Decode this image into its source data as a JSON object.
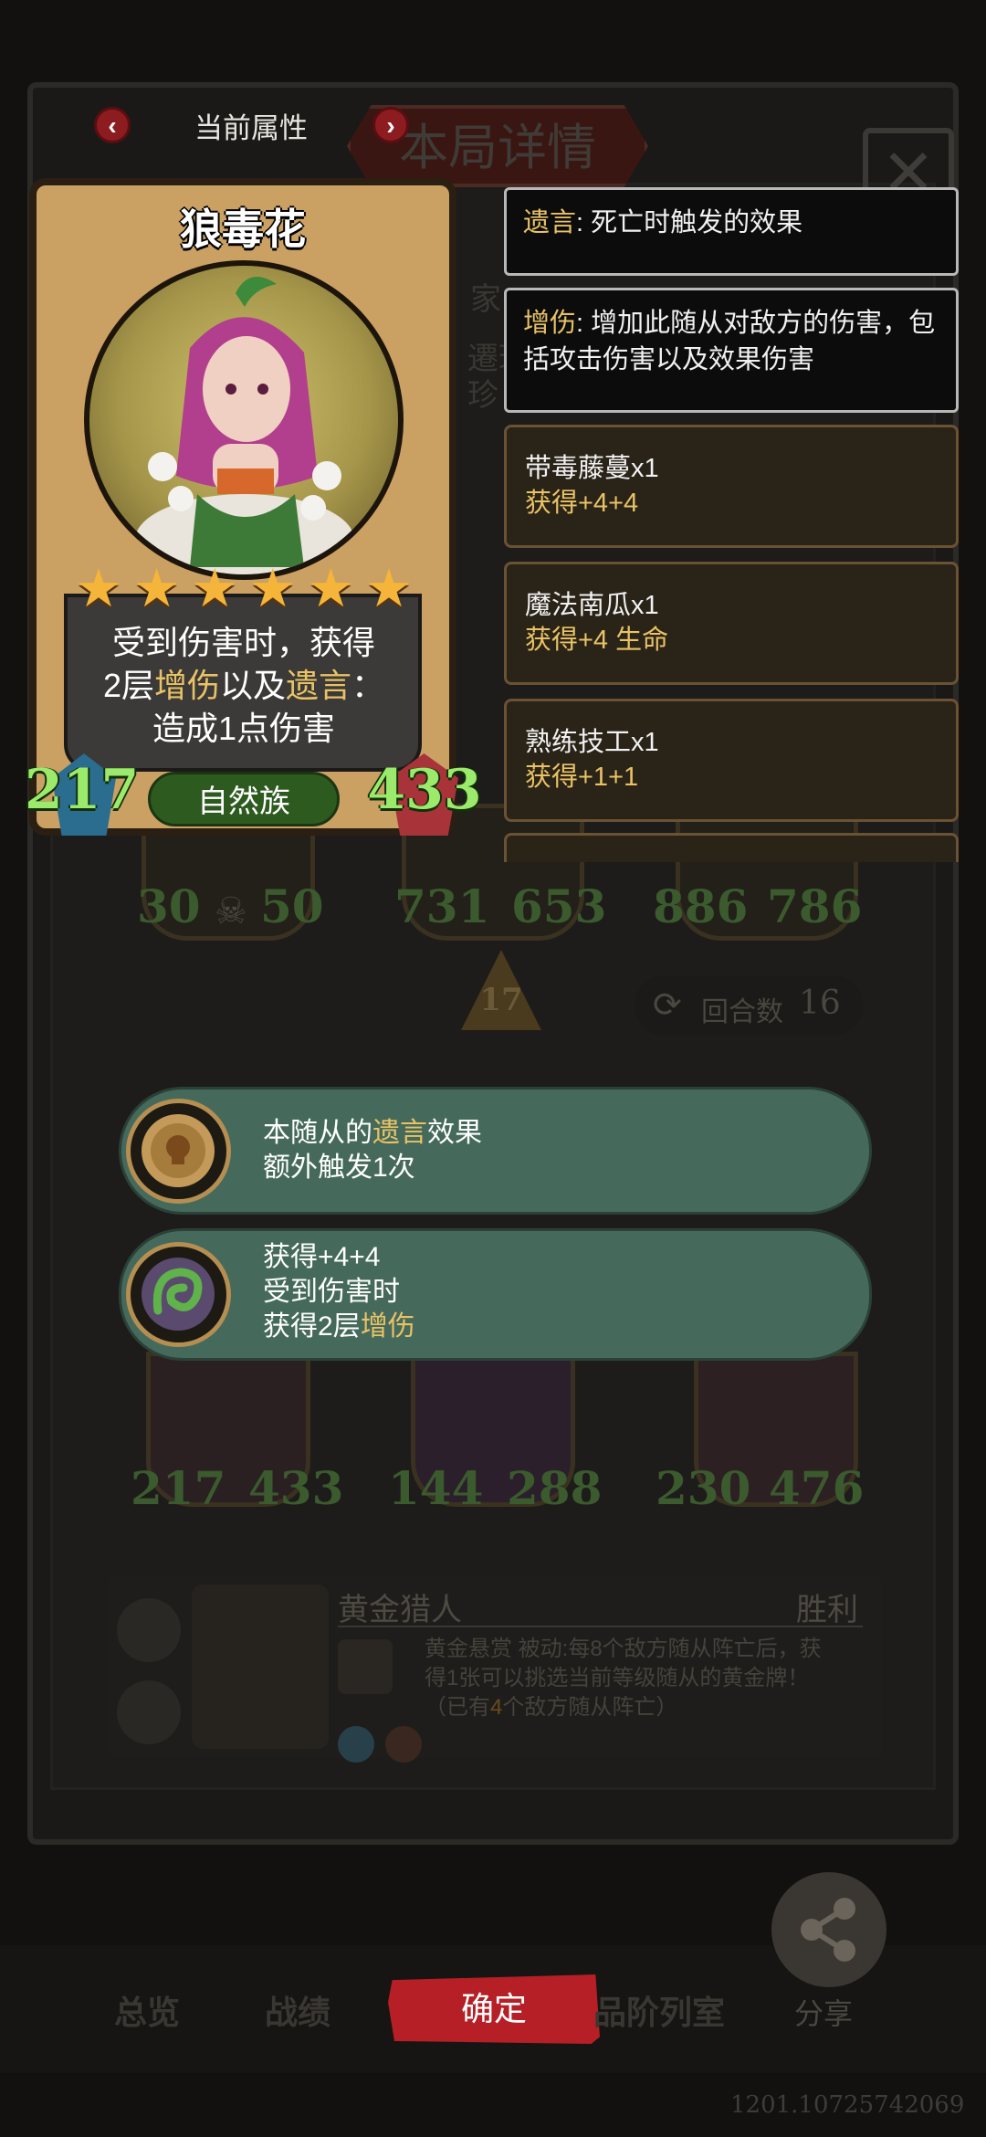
{
  "nav": {
    "prev_icon": "chevron-left-icon",
    "next_icon": "chevron-right-icon",
    "title": "当前属性"
  },
  "background": {
    "panel_title": "本局详情",
    "close_icon": "close-icon",
    "faint_a": "家",
    "faint_b": "遷珍",
    "faint_c": "珍",
    "top_stats": [
      {
        "atk": "30",
        "hp": "50"
      },
      {
        "atk": "731",
        "hp": "653"
      },
      {
        "atk": "886",
        "hp": "786"
      }
    ],
    "tier": "17",
    "round_label": "回合数",
    "round_value": "16",
    "bottom_stats": [
      {
        "atk": "217",
        "hp": "433"
      },
      {
        "atk": "144",
        "hp": "288"
      },
      {
        "atk": "230",
        "hp": "476"
      }
    ],
    "opponent_name": "黄金猎人",
    "result": "胜利",
    "skill_line1": "黄金悬赏 被动:每8个敌方随从阵亡后，获",
    "skill_line2": "得1张可以挑选当前等级随从的黄金牌！",
    "skill_line3_prefix": "（已有",
    "skill_line3_count": "4",
    "skill_line3_suffix": "个敌方随从阵亡）"
  },
  "card": {
    "name": "狼毒花",
    "stars": [
      "★",
      "★",
      "★",
      "★",
      "★",
      "★"
    ],
    "desc_line1": "受到伤害时，获得",
    "desc_line2_a": "2层",
    "desc_line2_kw1": "增伤",
    "desc_line2_b": "以及",
    "desc_line2_kw2": "遗言",
    "desc_line2_c": "：",
    "desc_line3": "造成1点伤害",
    "tribe": "自然族",
    "attack": "217",
    "health": "433"
  },
  "keywords": [
    {
      "kw": "遗言",
      "text": ": 死亡时触发的效果"
    },
    {
      "kw": "增伤",
      "text": ": 增加此随从对敌方的伤害，包括攻击伤害以及效果伤害"
    }
  ],
  "items": [
    {
      "name": "带毒藤蔓x1",
      "effect": "获得+4+4"
    },
    {
      "name": "魔法南瓜x1",
      "effect": "获得+4 生命"
    },
    {
      "name": "熟练技工x1",
      "effect": "获得+1+1"
    }
  ],
  "effects": [
    {
      "icon": "skull-coin-icon",
      "line1_a": "本随从的",
      "line1_kw": "遗言",
      "line1_b": "效果",
      "line2": "额外触发1次"
    },
    {
      "icon": "vine-icon",
      "line1": "获得+4+4",
      "line2": "受到伤害时",
      "line3_a": "获得2层",
      "line3_kw": "增伤"
    }
  ],
  "bottom": {
    "tab_overview": "总览",
    "tab_record": "战绩",
    "confirm": "确定",
    "tab_collection": "品阶列室",
    "share": "分享",
    "version": "1201.10725742069"
  },
  "colors": {
    "accent_red": "#b51f25",
    "keyword_gold": "#e8c265",
    "stat_green": "#9cea6b",
    "pill_green": "#456a5c"
  }
}
